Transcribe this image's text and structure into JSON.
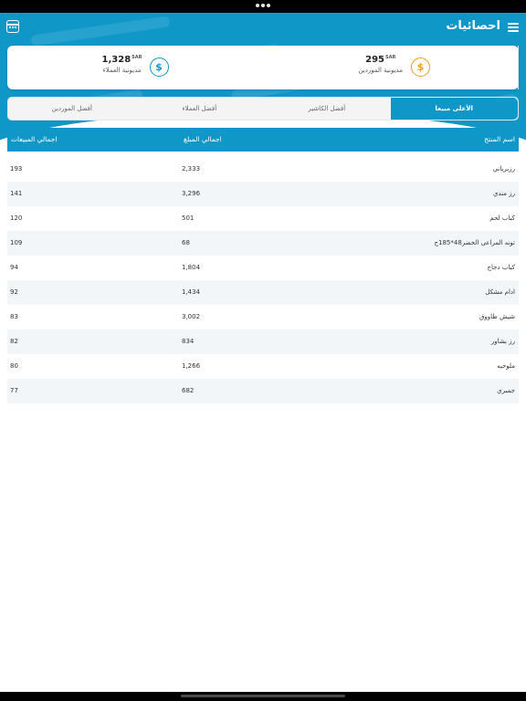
{
  "header": {
    "title": "احصائيات"
  },
  "stats": [
    {
      "value": "1,328",
      "currency": "SAR",
      "label": "مديونية العملاء",
      "icon": "dollar-circle-icon",
      "color": "#0f97c8"
    },
    {
      "value": "295",
      "currency": "SAR",
      "label": "مديونية الموردين",
      "icon": "dollar-circle-icon",
      "color": "#f0a020"
    }
  ],
  "tabs": [
    "الأعلى مبيعا",
    "أفضل الكاشير",
    "أفضل العملاء",
    "أفضل الموردين"
  ],
  "table": {
    "headers": {
      "name": "اسم المنتج",
      "amount": "اجمالي المبلغ",
      "qty": "اجمالي المبيعات"
    },
    "rows": [
      {
        "name": "رزبرياني",
        "amount": "2,333",
        "qty": "193"
      },
      {
        "name": "رز مندي",
        "amount": "3,296",
        "qty": "141"
      },
      {
        "name": "كباب لحم",
        "amount": "501",
        "qty": "120"
      },
      {
        "name": "تونه المراعى الخضر48*185ج",
        "amount": "68",
        "qty": "109"
      },
      {
        "name": "كباب دجاج",
        "amount": "1,804",
        "qty": "94"
      },
      {
        "name": "ادام مشكل",
        "amount": "1,434",
        "qty": "92"
      },
      {
        "name": "شيش طاووق",
        "amount": "3,002",
        "qty": "83"
      },
      {
        "name": "رز بشاور",
        "amount": "834",
        "qty": "82"
      },
      {
        "name": "ملوخيه",
        "amount": "1,266",
        "qty": "80"
      },
      {
        "name": "جمبري",
        "amount": "682",
        "qty": "77"
      }
    ]
  },
  "colors": {
    "primary": "#0f97c8",
    "accent_orange": "#f0a020"
  }
}
